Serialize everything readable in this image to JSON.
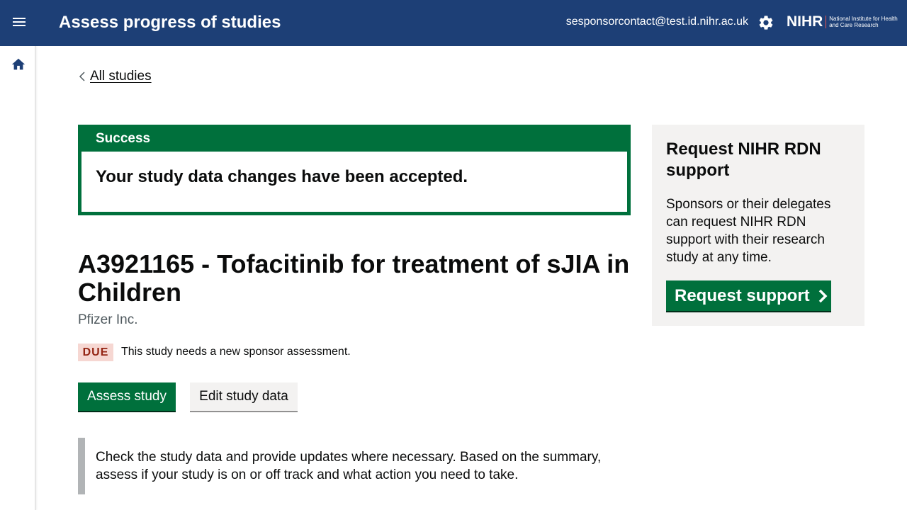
{
  "header": {
    "title": "Assess progress of studies",
    "user_email": "sesponsorcontact@test.id.nihr.ac.uk",
    "logo_mark": "NIHR",
    "logo_text": "National Institute for Health and Care Research",
    "icons": {
      "menu": "hamburger-menu-icon",
      "settings": "gear-icon"
    }
  },
  "sidebar": {
    "icons": {
      "home": "home-icon"
    }
  },
  "breadcrumb": {
    "back_label": "All studies"
  },
  "success_banner": {
    "heading": "Success",
    "message": "Your study data changes have been accepted."
  },
  "study": {
    "title": "A3921165 - Tofacitinib for treatment of sJIA in Children",
    "sponsor": "Pfizer Inc.",
    "status_tag": "DUE",
    "status_message": "This study needs a new sponsor assessment."
  },
  "actions": {
    "assess_label": "Assess study",
    "edit_label": "Edit study data"
  },
  "inset_text": "Check the study data and provide updates where necessary. Based on the summary, assess if your study is on or off track and what action you need to take.",
  "side_panel": {
    "title": "Request NIHR RDN support",
    "text": "Sponsors or their delegates can request NIHR RDN support with their research study at any time.",
    "button_label": "Request support"
  },
  "colors": {
    "header_bg": "#1d3f76",
    "success_green": "#00703c",
    "due_tag_bg": "#f6d7d2",
    "due_tag_text": "#942514",
    "panel_bg": "#f3f2f1"
  }
}
